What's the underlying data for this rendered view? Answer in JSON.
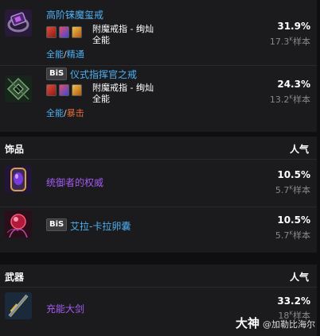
{
  "rings": [
    {
      "name": "高阶铼魔玺戒",
      "bis": "",
      "enchant": "附魔戒指 - 绚灿",
      "secondary": "全能",
      "stat_a": "全能",
      "stat_sep": "/",
      "stat_b": "精通",
      "stat_b_color": "#4db0f2",
      "percent": "31.9%",
      "count": "17.3",
      "count_sup": "K",
      "count_unit": "样本"
    },
    {
      "name": "仪式指挥官之戒",
      "bis": "BiS",
      "enchant": "附魔戒指 - 绚灿",
      "secondary": "全能",
      "stat_a": "全能",
      "stat_sep": "/",
      "stat_b": "暴击",
      "stat_b_color": "#e56a3c",
      "percent": "24.3%",
      "count": "13.2",
      "count_sup": "K",
      "count_unit": "样本"
    }
  ],
  "trinkets_section": {
    "title": "饰品",
    "popularity": "人气",
    "items": [
      {
        "name": "统御者的权威",
        "bis": "",
        "percent": "10.5%",
        "count": "5.7",
        "count_sup": "K",
        "count_unit": "样本"
      },
      {
        "name": "艾拉-卡拉卵囊",
        "bis": "BiS",
        "percent": "10.5%",
        "count": "5.7",
        "count_sup": "K",
        "count_unit": "样本"
      }
    ]
  },
  "weapons_section": {
    "title": "武器",
    "popularity": "人气",
    "items": [
      {
        "name": "充能大剑",
        "bis": "",
        "percent": "33.2%",
        "count": "18",
        "count_sup": "K",
        "count_unit": "样本"
      }
    ]
  },
  "watermark": {
    "brand": "大神",
    "handle": "@加勒比海尔"
  },
  "colors": {
    "epic_purple": "#a35bf0",
    "blue_link": "#4db0f2",
    "crit_orange": "#e56a3c",
    "panel": "#1b1b1e",
    "background": "#0f0f11"
  }
}
